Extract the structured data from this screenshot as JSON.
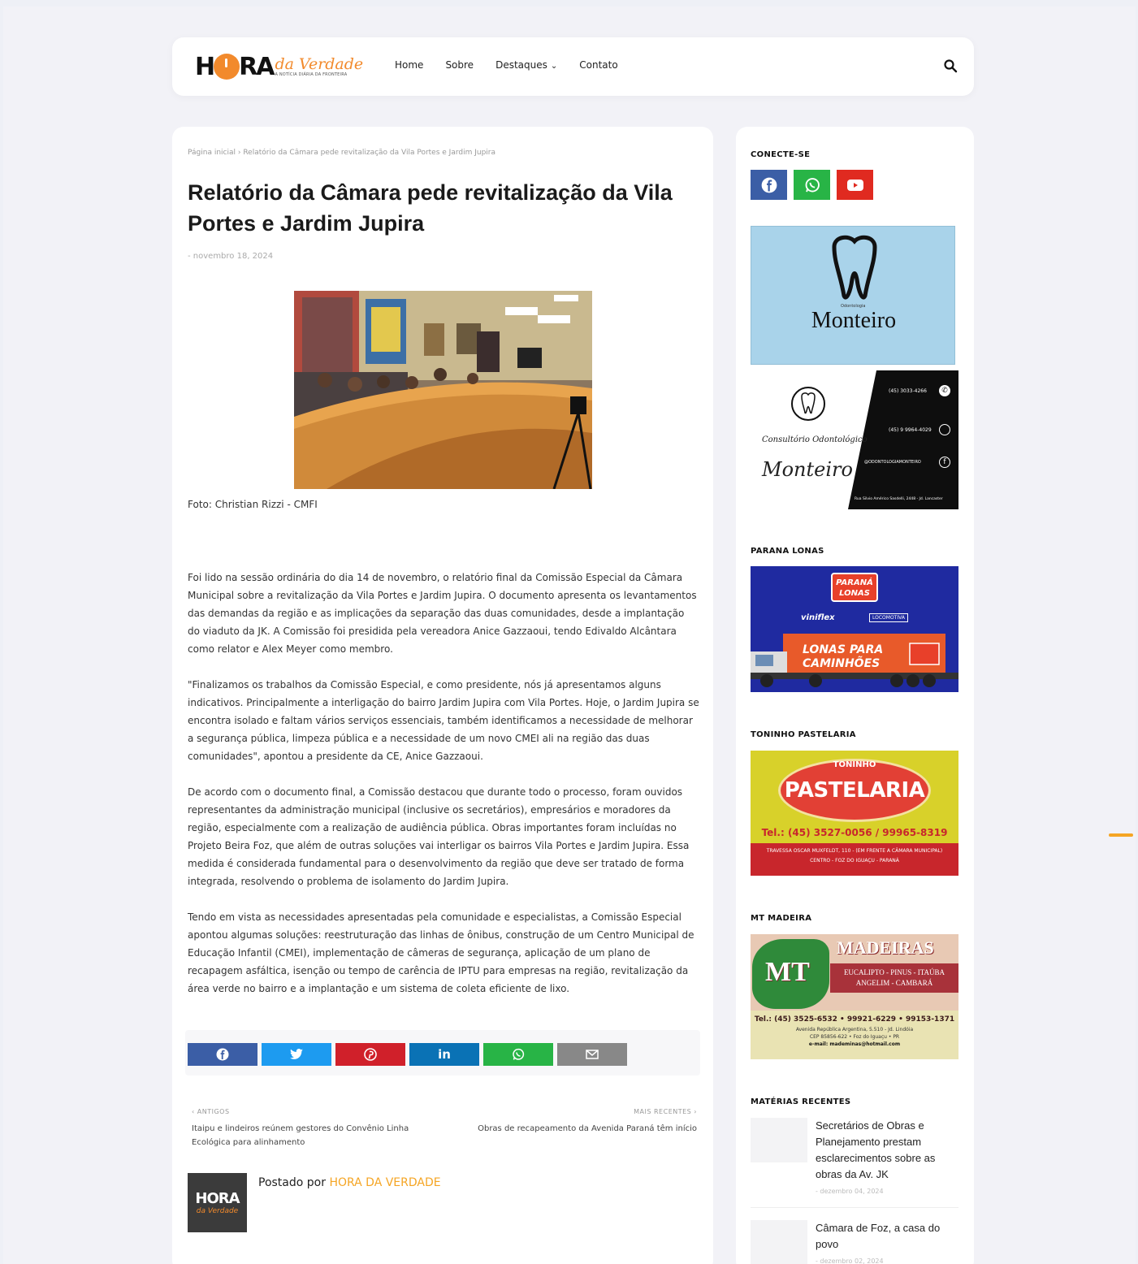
{
  "header": {
    "logo": {
      "h": "H",
      "ra": "RA",
      "da_verdade": "da Verdade",
      "tagline": "A NOTÍCIA DIÁRIA DA FRONTEIRA"
    },
    "nav": [
      {
        "label": "Home"
      },
      {
        "label": "Sobre"
      },
      {
        "label": "Destaques"
      },
      {
        "label": "Contato"
      }
    ]
  },
  "article": {
    "breadcrumb": "Página inicial › Relatório da Câmara pede revitalização da Vila Portes e Jardim Jupira",
    "title": "Relatório da Câmara pede revitalização da Vila Portes e Jardim Jupira",
    "date": "- novembro 18, 2024",
    "caption": "Foto: Christian Rizzi - CMFI",
    "paragraphs": [
      "Foi lido na sessão ordinária do dia 14 de novembro, o relatório final da Comissão Especial da Câmara Municipal sobre a revitalização da Vila Portes e Jardim Jupira. O documento apresenta os levantamentos das demandas da região e as implicações da separação das duas comunidades, desde a implantação do viaduto da JK. A Comissão foi presidida pela vereadora Anice Gazzaoui, tendo Edivaldo Alcântara como relator e Alex Meyer como membro.",
      "\"Finalizamos os trabalhos da Comissão Especial, e como presidente, nós já apresentamos alguns indicativos. Principalmente a interligação do bairro Jardim Jupira com Vila Portes. Hoje, o Jardim Jupira se encontra isolado e faltam vários serviços essenciais, também identificamos a necessidade de melhorar a segurança pública, limpeza pública e a necessidade de um novo CMEI ali na região das duas comunidades\", apontou a presidente da CE, Anice Gazzaoui.",
      "De acordo com o documento final, a Comissão destacou que durante todo o processo, foram ouvidos representantes da administração municipal (inclusive os secretários), empresários e moradores da região, especialmente com a realização de audiência pública. Obras importantes foram incluídas no Projeto Beira Foz, que além de outras soluções vai interligar os bairros Vila Portes e Jardim Jupira. Essa medida é considerada fundamental para o desenvolvimento da região que deve ser tratado de forma integrada, resolvendo o problema de isolamento do Jardim Jupira.",
      "Tendo em vista as necessidades apresentadas pela comunidade e especialistas, a Comissão Especial apontou algumas soluções: reestruturação das linhas de ônibus, construção de um Centro Municipal de Educação Infantil (CMEI), implementação de câmeras de segurança, aplicação de um plano de recapagem asfáltica, isenção ou tempo de carência de IPTU para empresas na região, revitalização da área verde no bairro e a implantação e um sistema de coleta eficiente de lixo."
    ],
    "share": [
      {
        "name": "facebook",
        "glyph": "f",
        "color": "#3b5ea6"
      },
      {
        "name": "twitter",
        "glyph": "t",
        "color": "#1d9bf0"
      },
      {
        "name": "pinterest",
        "glyph": "p",
        "color": "#d0202a"
      },
      {
        "name": "linkedin",
        "glyph": "in",
        "color": "#0a72b5"
      },
      {
        "name": "whatsapp",
        "glyph": "w",
        "color": "#28b446"
      },
      {
        "name": "email",
        "glyph": "✉",
        "color": "#888888"
      }
    ],
    "older_label": "‹ ANTIGOS",
    "older_title": "Itaipu e lindeiros reúnem gestores do Convênio Linha Ecológica para alinhamento",
    "newer_label": "MAIS RECENTES ›",
    "newer_title": "Obras de recapeamento da Avenida Paraná têm início",
    "posted_by": "Postado por",
    "author": "HORA DA VERDADE",
    "avatar_h": "HORA",
    "avatar_d": "da Verdade"
  },
  "sidebar": {
    "connect_title": "CONECTE-SE",
    "ad1": {
      "brand": "Monteiro",
      "small": "Odontologia",
      "script": "Monteiro",
      "sub": "Consultório Odontológico",
      "phone1": "(45) 3033-4266",
      "phone2": "(45) 9 9964-4029",
      "insta": "@ODONTOLOGIAMONTEIRO",
      "address": "Rua Silvio Américo Sasdelli, 2448 - Jd. Lancaster"
    },
    "w2_title": "PARANA LONAS",
    "ad2": {
      "logo_line1": "PARANÁ",
      "logo_line2": "LONAS",
      "brand1": "viniflex",
      "brand2": "LOCOMOTIVA",
      "slogan1": "LONAS PARA",
      "slogan2": "CAMINHÕES"
    },
    "w3_title": "TONINHO PASTELARIA",
    "ad3": {
      "arc": "TONINHO",
      "main": "PASTELARIA",
      "phone": "Tel.: (45) 3527-0056 / 99965-8319",
      "addr1": "TRAVESSA OSCAR MUXFELDT, 110 - (EM FRENTE A CÂMARA MUNICIPAL)",
      "addr2": "CENTRO - FOZ DO IGUAÇU - PARANÁ"
    },
    "w4_title": "MT MADEIRA",
    "ad4": {
      "mt": "MT",
      "title": "MADEIRAS",
      "woods1": "EUCALIPTO - PINUS - ITAÚBA",
      "woods2": "ANGELIM - CAMBARÁ",
      "phone": "Tel.: (45) 3525-6532 • 99921-6229 • 99153-1371",
      "addr1": "Avenida República Argentina, 5.510 - Jd. Lindóia",
      "addr2": "CEP 85856-622 • Foz do Iguaçu • PR",
      "email": "e-mail: mademinas@hotmail.com"
    },
    "recent_title": "MATÉRIAS RECENTES",
    "recent": [
      {
        "title": "Secretários de Obras e Planejamento prestam esclarecimentos sobre as obras da Av. JK",
        "date": "- dezembro 04, 2024"
      },
      {
        "title": "Câmara de Foz, a casa do povo",
        "date": "- dezembro 02, 2024"
      }
    ]
  }
}
